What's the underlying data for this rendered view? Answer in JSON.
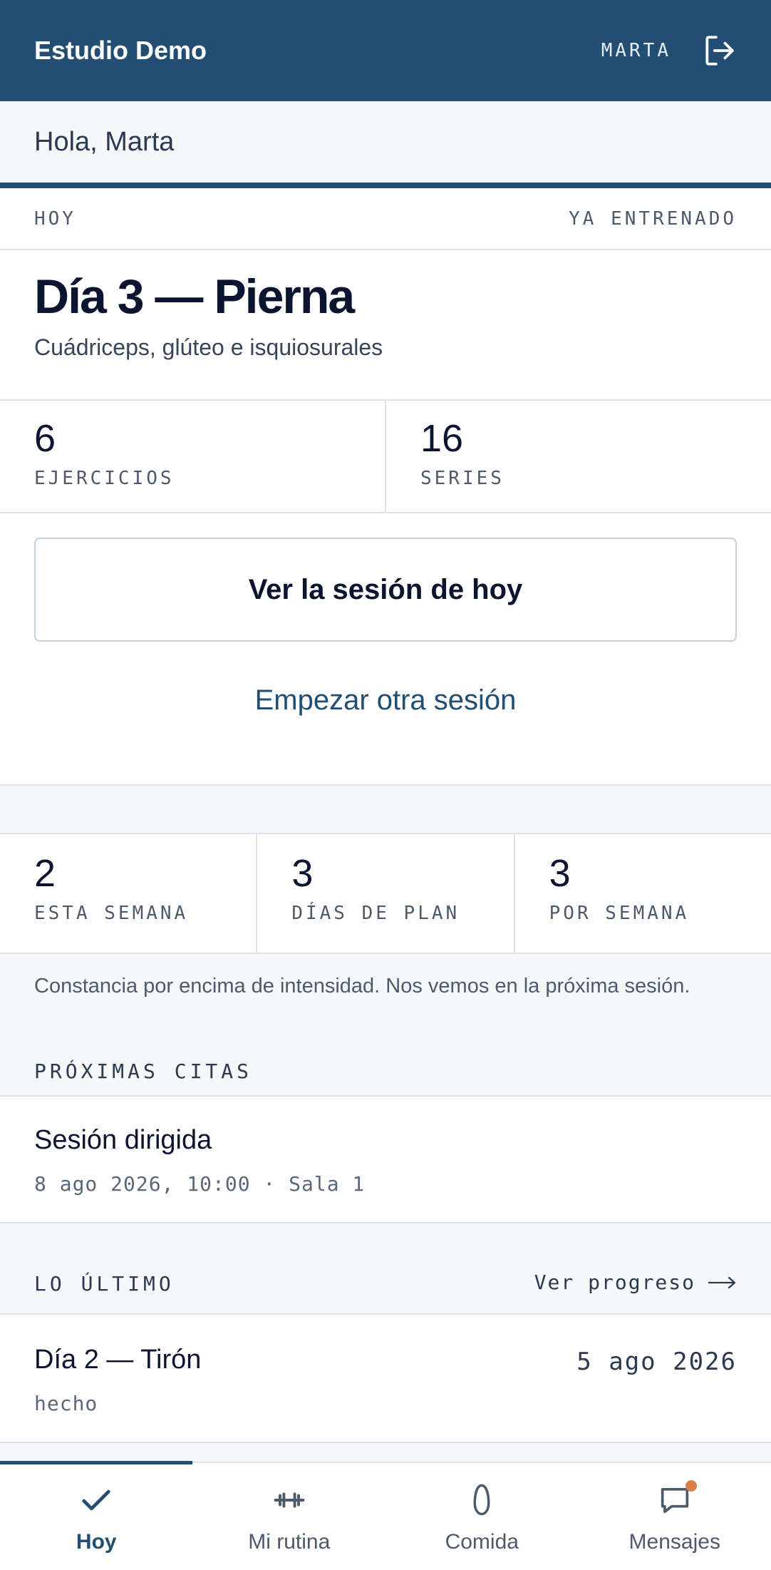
{
  "header": {
    "brand": "Estudio Demo",
    "user": "MARTA",
    "logout_icon": "logout-icon",
    "bg_color": "#214e72"
  },
  "greeting": "Hola, Marta",
  "today": {
    "label": "HOY",
    "status": "YA ENTRENADO",
    "title": "Día 3 — Pierna",
    "subtitle": "Cuádriceps, glúteo e isquiosurales",
    "stats": [
      {
        "value": "6",
        "label": "EJERCICIOS"
      },
      {
        "value": "16",
        "label": "SERIES"
      }
    ],
    "primary_button": "Ver la sesión de hoy",
    "secondary_button": "Empezar otra sesión"
  },
  "week_stats": [
    {
      "value": "2",
      "label": "ESTA SEMANA"
    },
    {
      "value": "3",
      "label": "DÍAS DE PLAN"
    },
    {
      "value": "3",
      "label": "POR SEMANA"
    }
  ],
  "quote": "Constancia por encima de intensidad. Nos vemos en la próxima sesión.",
  "appointments": {
    "label": "PRÓXIMAS CITAS",
    "items": [
      {
        "title": "Sesión dirigida",
        "meta": "8 ago 2026, 10:00 · Sala 1"
      }
    ]
  },
  "latest": {
    "label": "LO ÚLTIMO",
    "link": "Ver progreso",
    "items": [
      {
        "title": "Día 2 — Tirón",
        "date": "5 ago 2026",
        "status": "hecho"
      }
    ]
  },
  "tabs": [
    {
      "label": "Hoy",
      "icon": "check-icon",
      "active": true
    },
    {
      "label": "Mi rutina",
      "icon": "dumbbell-icon",
      "active": false
    },
    {
      "label": "Comida",
      "icon": "egg-icon",
      "active": false
    },
    {
      "label": "Mensajes",
      "icon": "message-icon",
      "active": false,
      "notification": true
    }
  ],
  "colors": {
    "accent": "#214e72",
    "notification": "#d7804a"
  }
}
